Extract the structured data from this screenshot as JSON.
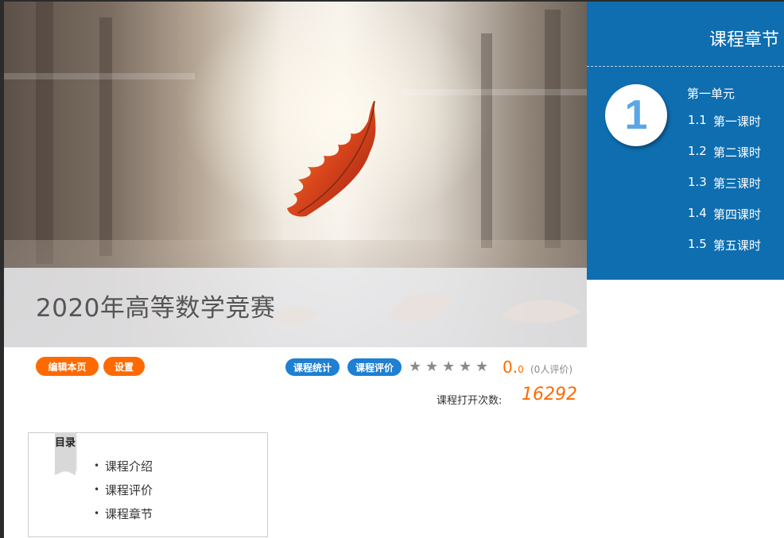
{
  "banner": {
    "title": "2020年高等数学竞赛"
  },
  "chapter_panel": {
    "header": "课程章节",
    "unit_number": "1",
    "unit_title": "第一单元",
    "lessons": [
      {
        "num": "1.1",
        "title": "第一课时"
      },
      {
        "num": "1.2",
        "title": "第二课时"
      },
      {
        "num": "1.3",
        "title": "第三课时"
      },
      {
        "num": "1.4",
        "title": "第四课时"
      },
      {
        "num": "1.5",
        "title": "第五课时"
      }
    ]
  },
  "actions": {
    "edit_label": "编辑本页",
    "settings_label": "设置",
    "stats_label": "课程统计",
    "review_label": "课程评价"
  },
  "rating": {
    "stars_filled": 0,
    "stars_total": 5,
    "score_main": "0.",
    "score_decimal": "0",
    "count_text": "(0人评价)"
  },
  "open_count": {
    "label": "课程打开次数:",
    "value": "16292"
  },
  "toc": {
    "tag": "目录",
    "items": [
      "课程介绍",
      "课程评价",
      "课程章节"
    ]
  },
  "colors": {
    "accent_orange": "#ff6a00",
    "accent_blue": "#1e7fd3",
    "panel_blue": "#0e6eb0"
  }
}
